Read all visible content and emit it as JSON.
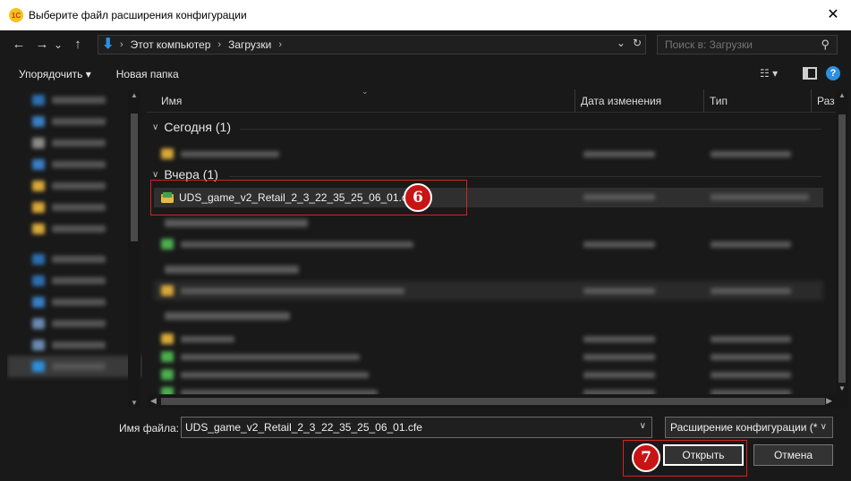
{
  "window": {
    "title": "Выберите файл расширения конфигурации",
    "app_icon_text": "1С",
    "close_glyph": "✕"
  },
  "nav": {
    "back_glyph": "←",
    "forward_glyph": "→",
    "recent_glyph": "⌄",
    "up_glyph": "↑",
    "breadcrumbs": [
      "Этот компьютер",
      "Загрузки"
    ],
    "breadcrumb_sep": "›",
    "dropdown_glyph": "⌄",
    "refresh_glyph": "↻",
    "search_placeholder": "Поиск в: Загрузки",
    "search_icon_glyph": "⚲"
  },
  "toolbar": {
    "organize_label": "Упорядочить ▾",
    "new_folder_label": "Новая папка",
    "view_glyph": "☷ ▾",
    "help_glyph": "?"
  },
  "columns": {
    "name": "Имя",
    "date": "Дата изменения",
    "type": "Тип",
    "size": "Раз"
  },
  "groups": {
    "today": "Сегодня (1)",
    "yesterday": "Вчера (1)"
  },
  "selected_file": {
    "name": "UDS_game_v2_Retail_2_3_22_35_25_06_01.cfe"
  },
  "bottom": {
    "filename_label": "Имя файла:",
    "filename_value": "UDS_game_v2_Retail_2_3_22_35_25_06_01.cfe",
    "filter_value": "Расширение конфигурации (*",
    "open_label": "Открыть",
    "cancel_label": "Отмена"
  },
  "annotations": {
    "step6": "6",
    "step7": "7"
  },
  "colors": {
    "background": "#191919",
    "annotation_red": "#c81414",
    "accent_blue": "#2d8fe0",
    "folder_yellow": "#d9a93a"
  }
}
